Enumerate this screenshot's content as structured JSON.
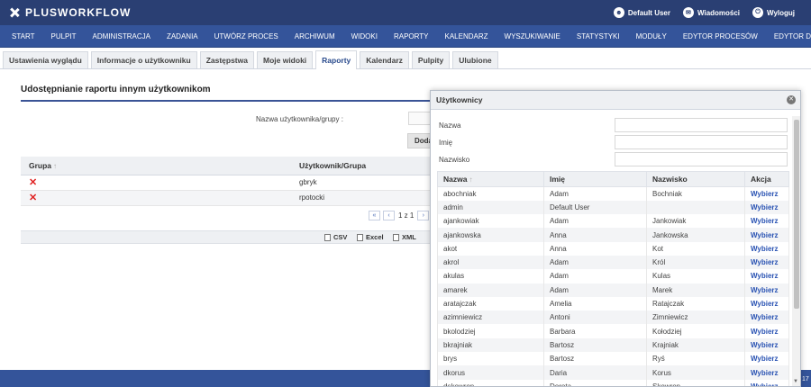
{
  "app": {
    "logo_text": "PLUSWORKFLOW",
    "user_label": "Default User",
    "messages_label": "Wiadomości",
    "logout_label": "Wyloguj"
  },
  "nav": [
    "START",
    "PULPIT",
    "ADMINISTRACJA",
    "ZADANIA",
    "UTWÓRZ PROCES",
    "ARCHIWUM",
    "WIDOKI",
    "RAPORTY",
    "KALENDARZ",
    "WYSZUKIWANIE",
    "STATYSTYKI",
    "MODUŁY",
    "EDYTOR PROCESÓW",
    "EDYTOR DANYCH"
  ],
  "subtabs": [
    {
      "label": "Ustawienia wyglądu",
      "active": false
    },
    {
      "label": "Informacje o użytkowniku",
      "active": false
    },
    {
      "label": "Zastępstwa",
      "active": false
    },
    {
      "label": "Moje widoki",
      "active": false
    },
    {
      "label": "Raporty",
      "active": true
    },
    {
      "label": "Kalendarz",
      "active": false
    },
    {
      "label": "Pulpity",
      "active": false
    },
    {
      "label": "Ulubione",
      "active": false
    }
  ],
  "share": {
    "title": "Udostępnianie raportu innym użytkownikom",
    "field_label": "Nazwa użytkownika/grupy :",
    "add_button": "Dodaj",
    "columns": [
      "Grupa",
      "Użytkownik/Grupa"
    ],
    "rows": [
      {
        "group": "",
        "user": "gbryk"
      },
      {
        "group": "",
        "user": "rpotocki"
      }
    ],
    "pager": {
      "text": "1 z 1"
    },
    "exports": [
      "CSV",
      "Excel",
      "XML"
    ]
  },
  "modal": {
    "title": "Użytkownicy",
    "filters": [
      {
        "label": "Nazwa",
        "value": ""
      },
      {
        "label": "Imię",
        "value": ""
      },
      {
        "label": "Nazwisko",
        "value": ""
      }
    ],
    "columns": [
      "Nazwa",
      "Imię",
      "Nazwisko",
      "Akcja"
    ],
    "action_label": "Wybierz",
    "rows": [
      [
        "abochniak",
        "Adam",
        "Bochniak"
      ],
      [
        "admin",
        "Default User",
        ""
      ],
      [
        "ajankowiak",
        "Adam",
        "Jankowiak"
      ],
      [
        "ajankowska",
        "Anna",
        "Jankowska"
      ],
      [
        "akot",
        "Anna",
        "Kot"
      ],
      [
        "akrol",
        "Adam",
        "Król"
      ],
      [
        "akulas",
        "Adam",
        "Kulas"
      ],
      [
        "amarek",
        "Adam",
        "Marek"
      ],
      [
        "aratajczak",
        "Amelia",
        "Ratajczak"
      ],
      [
        "azimniewicz",
        "Antoni",
        "Zimniewicz"
      ],
      [
        "bkolodziej",
        "Barbara",
        "Kołodziej"
      ],
      [
        "bkrajniak",
        "Bartosz",
        "Krajniak"
      ],
      [
        "brys",
        "Bartosz",
        "Ryś"
      ],
      [
        "dkorus",
        "Daria",
        "Korus"
      ],
      [
        "dskowron",
        "Dorota",
        "Skowron"
      ]
    ]
  },
  "footer": {
    "corner": "17"
  }
}
